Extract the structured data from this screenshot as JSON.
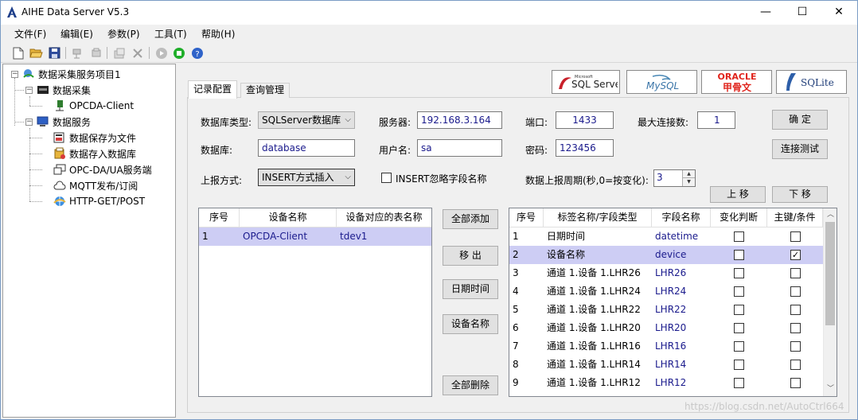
{
  "window": {
    "title": "AIHE Data Server V5.3",
    "min": "—",
    "max": "☐",
    "close": "✕"
  },
  "menu": [
    "文件(F)",
    "编辑(E)",
    "参数(P)",
    "工具(T)",
    "帮助(H)"
  ],
  "tree": {
    "root": "数据采集服务项目1",
    "collect": "数据采集",
    "opcda_client": "OPCDA-Client",
    "service": "数据服务",
    "svc_items": [
      "数据保存为文件",
      "数据存入数据库",
      "OPC-DA/UA服务端",
      "MQTT发布/订阅",
      "HTTP-GET/POST"
    ]
  },
  "tabs": [
    "记录配置",
    "查询管理"
  ],
  "logos": {
    "sqlserver": "SQL Server",
    "sqlserver_small": "Microsoft",
    "mysql": "MySQL",
    "oracle": "ORACLE",
    "oracle_cn": "甲骨文",
    "sqlite": "SQLite"
  },
  "form": {
    "db_type_label": "数据库类型:",
    "db_type_value": "SQLServer数据库",
    "server_label": "服务器:",
    "server_value": "192.168.3.164",
    "port_label": "端口:",
    "port_value": "1433",
    "max_conn_label": "最大连接数:",
    "max_conn_value": "1",
    "ok_button": "确  定",
    "database_label": "数据库:",
    "database_value": "database",
    "user_label": "用户名:",
    "user_value": "sa",
    "password_label": "密码:",
    "password_value": "123456",
    "test_button": "连接测试",
    "upload_label": "上报方式:",
    "upload_value": "INSERT方式插入",
    "ignore_label": "INSERT忽略字段名称",
    "ignore_checked": false,
    "period_label": "数据上报周期(秒,0=按变化):",
    "period_value": "3",
    "move_up": "上 移",
    "move_down": "下 移"
  },
  "device_grid": {
    "headers": [
      "序号",
      "设备名称",
      "设备对应的表名称"
    ],
    "rows": [
      {
        "no": "1",
        "name": "OPCDA-Client",
        "table": "tdev1"
      }
    ]
  },
  "middle_buttons": [
    "全部添加",
    "移 出",
    "日期时间",
    "设备名称",
    "全部删除"
  ],
  "field_grid": {
    "headers": [
      "序号",
      "标签名称/字段类型",
      "字段名称",
      "变化判断",
      "主键/条件"
    ],
    "rows": [
      {
        "no": "1",
        "tag": "日期时间",
        "field": "datetime",
        "change": false,
        "key": false
      },
      {
        "no": "2",
        "tag": "设备名称",
        "field": "device",
        "change": false,
        "key": true
      },
      {
        "no": "3",
        "tag": "通道 1.设备 1.LHR26",
        "field": "LHR26",
        "change": false,
        "key": false
      },
      {
        "no": "4",
        "tag": "通道 1.设备 1.LHR24",
        "field": "LHR24",
        "change": false,
        "key": false
      },
      {
        "no": "5",
        "tag": "通道 1.设备 1.LHR22",
        "field": "LHR22",
        "change": false,
        "key": false
      },
      {
        "no": "6",
        "tag": "通道 1.设备 1.LHR20",
        "field": "LHR20",
        "change": false,
        "key": false
      },
      {
        "no": "7",
        "tag": "通道 1.设备 1.LHR16",
        "field": "LHR16",
        "change": false,
        "key": false
      },
      {
        "no": "8",
        "tag": "通道 1.设备 1.LHR14",
        "field": "LHR14",
        "change": false,
        "key": false
      },
      {
        "no": "9",
        "tag": "通道 1.设备 1.LHR12",
        "field": "LHR12",
        "change": false,
        "key": false
      }
    ]
  },
  "watermark": "https://blog.csdn.net/AutoCtrl664"
}
